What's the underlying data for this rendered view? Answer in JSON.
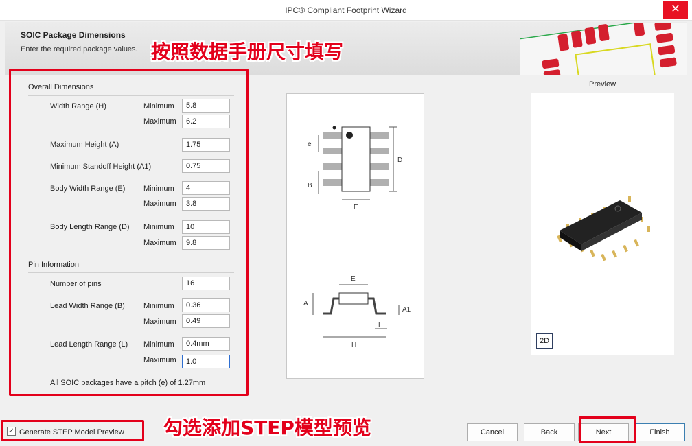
{
  "window": {
    "title": "IPC® Compliant Footprint Wizard",
    "close_glyph": "✕"
  },
  "header": {
    "title": "SOIC Package Dimensions",
    "subtitle": "Enter the required package values."
  },
  "annotations": {
    "top": "按照数据手册尺寸填写",
    "bottom": "勾选添加STEP模型预览"
  },
  "overall": {
    "heading": "Overall Dimensions",
    "width_range_label": "Width Range (H)",
    "max_height_label": "Maximum Height (A)",
    "min_standoff_label": "Minimum Standoff Height (A1)",
    "body_width_label": "Body Width Range (E)",
    "body_length_label": "Body Length Range (D)",
    "width_min": "5.8",
    "width_max": "6.2",
    "max_height": "1.75",
    "min_standoff": "0.75",
    "body_width_min": "4",
    "body_width_max": "3.8",
    "body_length_min": "10",
    "body_length_max": "9.8"
  },
  "pins": {
    "heading": "Pin Information",
    "num_pins_label": "Number of pins",
    "lead_width_label": "Lead Width Range (B)",
    "lead_length_label": "Lead Length Range (L)",
    "num_pins": "16",
    "lead_width_min": "0.36",
    "lead_width_max": "0.49",
    "lead_length_min": "0.4mm",
    "lead_length_max": "1.0",
    "pitch_note": "All SOIC packages have a pitch (e) of 1.27mm"
  },
  "labels": {
    "minimum": "Minimum",
    "maximum": "Maximum"
  },
  "diagram": {
    "e": "e",
    "b": "B",
    "d": "D",
    "e_body": "E",
    "a": "A",
    "a1": "A1",
    "l": "L",
    "h": "H"
  },
  "preview": {
    "label": "Preview",
    "mode_button": "2D"
  },
  "footer": {
    "step_checkbox_label": "Generate STEP Model Preview",
    "step_checked": true,
    "cancel": "Cancel",
    "back": "Back",
    "next": "Next",
    "finish": "Finish"
  },
  "colors": {
    "annotation": "#e3001b",
    "pad_red": "#d41f2e",
    "pcb_green": "#2aa84a"
  }
}
